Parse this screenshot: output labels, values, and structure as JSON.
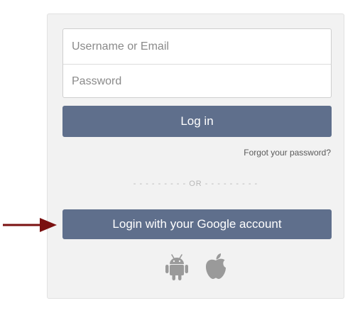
{
  "login_form": {
    "username_placeholder": "Username or Email",
    "password_placeholder": "Password",
    "login_button_label": "Log in",
    "forgot_password_link": "Forgot your password?",
    "divider_text": "- - - - - - - - - OR - - - - - - - - -",
    "google_login_button_label": "Login with your Google account",
    "platform_icons": [
      "android-icon",
      "apple-icon"
    ]
  },
  "annotation": {
    "arrow_icon": "arrow-right-icon",
    "arrow_color": "#7a1010"
  },
  "colors": {
    "button_background": "#5f6f8c",
    "panel_background": "#f2f2f2"
  }
}
